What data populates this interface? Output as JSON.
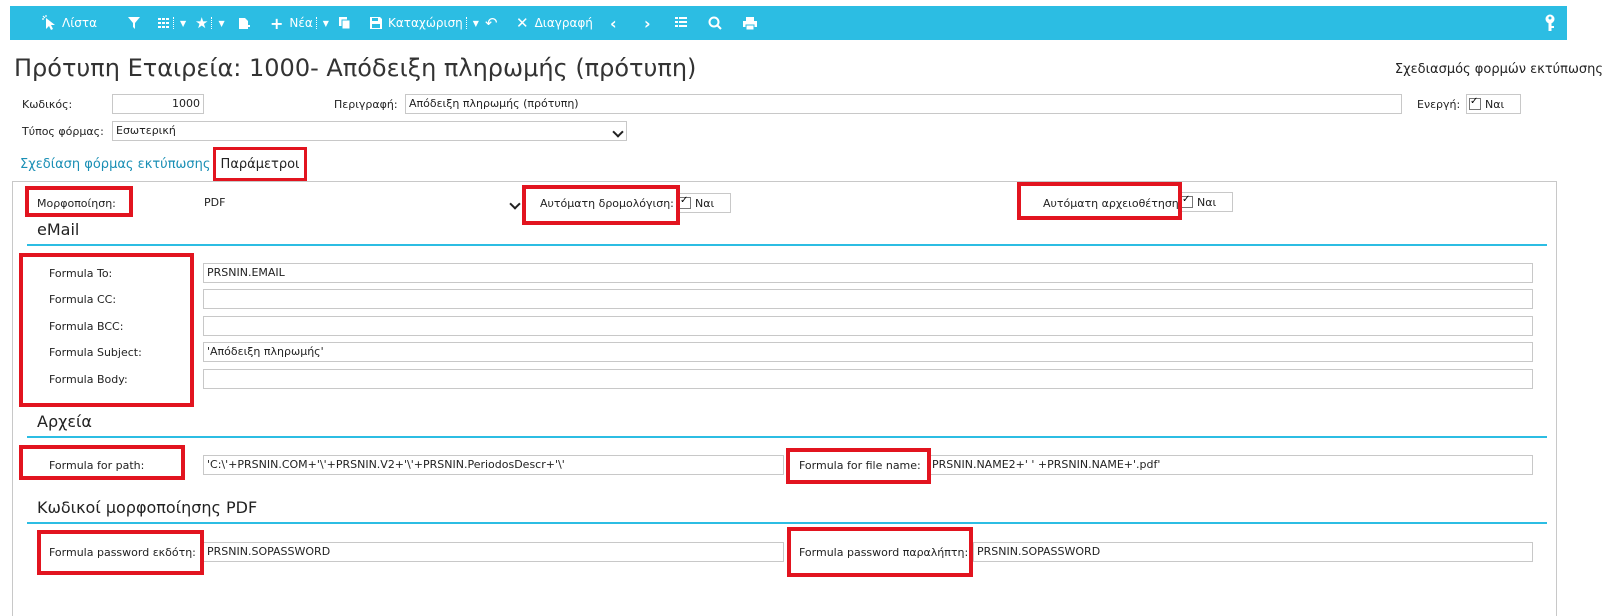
{
  "toolbar": {
    "list": "Λίστα",
    "new": "Νέα",
    "save": "Καταχώριση",
    "delete": "Διαγραφή"
  },
  "header": {
    "title": "Πρότυπη Εταιρεία: 1000- Απόδειξη πληρωμής (πρότυπη)",
    "design_link": "Σχεδιασμός φορμών εκτύπωσης"
  },
  "form": {
    "code_label": "Κωδικός:",
    "code_value": "1000",
    "desc_label": "Περιγραφή:",
    "desc_value": "Απόδειξη πληρωμής (πρότυπη)",
    "active_label": "Ενεργή:",
    "active_value": "Ναι",
    "type_label": "Τύπος φόρμας:",
    "type_value": "Εσωτερική"
  },
  "tabs": {
    "design": "Σχεδίαση φόρμας εκτύπωσης",
    "params": "Παράμετροι"
  },
  "params": {
    "format_label": "Μορφοποίηση:",
    "format_value": "PDF",
    "auto_route_label": "Αυτόματη δρομολόγιση:",
    "auto_route_value": "Ναι",
    "auto_archive_label": "Αυτόματη αρχειοθέτηση:",
    "auto_archive_value": "Ναι"
  },
  "email": {
    "section": "eMail",
    "to_label": "Formula To:",
    "to_value": "PRSNIN.EMAIL",
    "cc_label": "Formula CC:",
    "cc_value": "",
    "bcc_label": "Formula BCC:",
    "bcc_value": "",
    "subject_label": "Formula Subject:",
    "subject_value": "'Απόδειξη πληρωμής'",
    "body_label": "Formula Body:",
    "body_value": ""
  },
  "files": {
    "section": "Αρχεία",
    "path_label": "Formula for path:",
    "path_value": "'C:\\'+PRSNIN.COM+'\\'+PRSNIN.V2+'\\'+PRSNIN.PeriodosDescr+'\\'",
    "filename_label": "Formula for file name:",
    "filename_value": "PRSNIN.NAME2+' ' +PRSNIN.NAME+'.pdf'"
  },
  "pdf": {
    "section": "Κωδικοί μορφοποίησης PDF",
    "issuer_label": "Formula password εκδότη:",
    "issuer_value": "PRSNIN.SOPASSWORD",
    "recipient_label": "Formula password παραλήπτη:",
    "recipient_value": "PRSNIN.SOPASSWORD"
  },
  "colors": {
    "toolbar": "#2cbde3",
    "highlight": "#e2141f",
    "link": "#1a8fb5"
  }
}
